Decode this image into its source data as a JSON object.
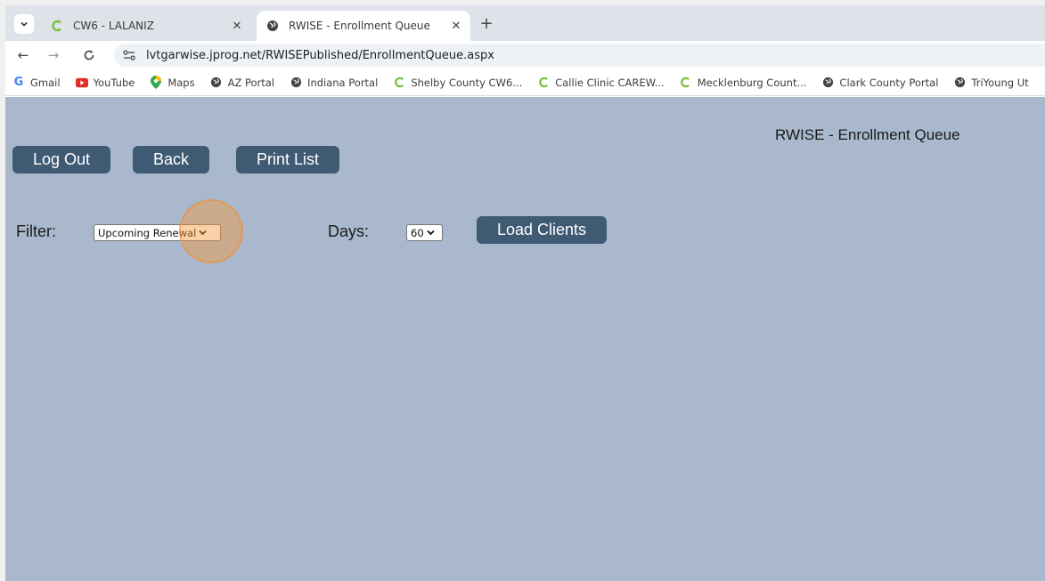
{
  "browser": {
    "tabs": [
      {
        "title": "CW6 - LALANIZ",
        "icon": "careware-icon",
        "active": false
      },
      {
        "title": "RWISE - Enrollment Queue",
        "icon": "globe-icon",
        "active": true
      }
    ],
    "url": "lvtgarwise.jprog.net/RWISEPublished/EnrollmentQueue.aspx",
    "bookmarks": [
      {
        "label": "Gmail",
        "icon": "google-icon"
      },
      {
        "label": "YouTube",
        "icon": "youtube-icon"
      },
      {
        "label": "Maps",
        "icon": "maps-pin-icon"
      },
      {
        "label": "AZ Portal",
        "icon": "globe-icon"
      },
      {
        "label": "Indiana Portal",
        "icon": "globe-icon"
      },
      {
        "label": "Shelby County CW6...",
        "icon": "careware-icon"
      },
      {
        "label": "Callie Clinic CAREW...",
        "icon": "careware-icon"
      },
      {
        "label": "Mecklenburg Count...",
        "icon": "careware-icon"
      },
      {
        "label": "Clark County Portal",
        "icon": "globe-icon"
      },
      {
        "label": "TriYoung Ut",
        "icon": "globe-icon"
      }
    ]
  },
  "page": {
    "title": "RWISE - Enrollment Queue",
    "buttons": {
      "logout": "Log Out",
      "back": "Back",
      "print": "Print List",
      "load": "Load Clients"
    },
    "filter": {
      "label": "Filter:",
      "value": "Upcoming Renewal"
    },
    "days": {
      "label": "Days:",
      "value": "60"
    }
  },
  "colors": {
    "page_background": "#a9b8cc",
    "button": "#3f5a73",
    "cursor_highlight": "#f5963c"
  }
}
